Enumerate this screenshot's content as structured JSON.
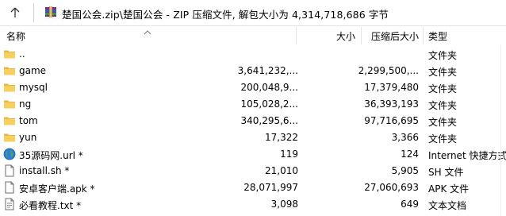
{
  "addressbar": {
    "up_icon": "up-arrow-icon",
    "archive_icon": "winrar-archive-icon",
    "path": "楚国公会.zip\\楚国公会 - ZIP 压缩文件, 解包大小为 4,314,718,686 字节"
  },
  "columns": {
    "name": "名称",
    "size": "大小",
    "packed": "压缩后大小",
    "type": "类型",
    "sort_icon": "sort-ascending-icon"
  },
  "rows": [
    {
      "name": "..",
      "size": "",
      "packed": "",
      "type": "文件夹",
      "icon": "folder-icon"
    },
    {
      "name": "game",
      "size": "3,641,232,...",
      "packed": "2,299,500,...",
      "type": "文件夹",
      "icon": "folder-icon"
    },
    {
      "name": "mysql",
      "size": "200,048,9...",
      "packed": "17,379,480",
      "type": "文件夹",
      "icon": "folder-icon"
    },
    {
      "name": "ng",
      "size": "105,028,2...",
      "packed": "36,393,193",
      "type": "文件夹",
      "icon": "folder-icon"
    },
    {
      "name": "tom",
      "size": "340,295,6...",
      "packed": "97,716,695",
      "type": "文件夹",
      "icon": "folder-icon"
    },
    {
      "name": "yun",
      "size": "17,322",
      "packed": "3,366",
      "type": "文件夹",
      "icon": "folder-icon"
    },
    {
      "name": "35源码网.url *",
      "size": "119",
      "packed": "124",
      "type": "Internet 快捷方式",
      "icon": "globe-icon"
    },
    {
      "name": "install.sh *",
      "size": "21,010",
      "packed": "5,905",
      "type": "SH 文件",
      "icon": "file-icon"
    },
    {
      "name": "安卓客户端.apk *",
      "size": "28,071,997",
      "packed": "27,060,693",
      "type": "APK 文件",
      "icon": "file-icon"
    },
    {
      "name": "必看教程.txt *",
      "size": "3,098",
      "packed": "649",
      "type": "文本文档",
      "icon": "text-file-icon"
    }
  ]
}
